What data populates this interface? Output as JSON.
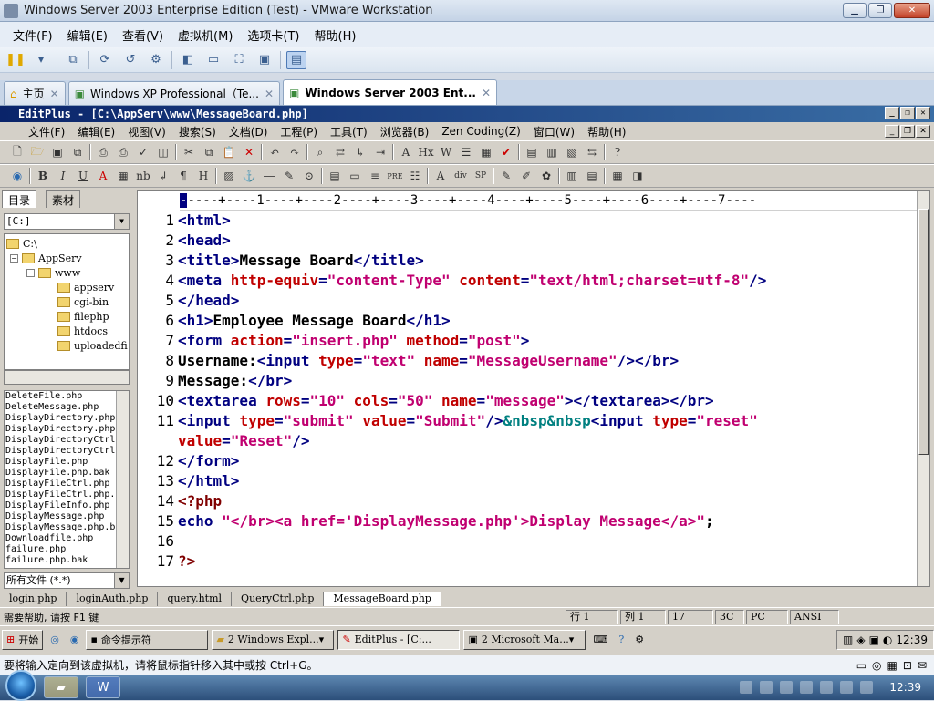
{
  "vmware": {
    "title": "Windows Server 2003 Enterprise Edition (Test) - VMware Workstation",
    "menu": [
      "文件(F)",
      "编辑(E)",
      "查看(V)",
      "虚拟机(M)",
      "选项卡(T)",
      "帮助(H)"
    ],
    "tabs": [
      {
        "label": "主页"
      },
      {
        "label": "Windows XP Professional（Te..."
      },
      {
        "label": "Windows Server 2003 Ent..."
      }
    ]
  },
  "editplus": {
    "title": "EditPlus - [C:\\AppServ\\www\\MessageBoard.php]",
    "menu": [
      "文件(F)",
      "编辑(E)",
      "视图(V)",
      "搜索(S)",
      "文档(D)",
      "工程(P)",
      "工具(T)",
      "浏览器(B)",
      "Zen Coding(Z)",
      "窗口(W)",
      "帮助(H)"
    ],
    "left_tabs": [
      "目录",
      "素材"
    ],
    "drive": "[C:]",
    "tree": [
      "C:\\",
      "AppServ",
      "www",
      "appserv",
      "cgi-bin",
      "filephp",
      "htdocs",
      "uploadedfi"
    ],
    "files": [
      "DeleteFile.php",
      "DeleteMessage.php",
      "DisplayDirectory.php",
      "DisplayDirectory.php",
      "DisplayDirectoryCtrl",
      "DisplayDirectoryCtrl",
      "DisplayFile.php",
      "DisplayFile.php.bak",
      "DisplayFileCtrl.php",
      "DisplayFileCtrl.php.",
      "DisplayFileInfo.php",
      "DisplayMessage.php",
      "DisplayMessage.php.b",
      "Downloadfile.php",
      "failure.php",
      "failure.php.bak"
    ],
    "filter": "所有文件 (*.*)",
    "ruler": "----+----1----+----2----+----3----+----4----+----5----+----6----+----7----",
    "line_numbers": [
      "1",
      "2",
      "3",
      "4",
      "5",
      "6",
      "7",
      "8",
      "9",
      "10",
      "11",
      "",
      "12",
      "13",
      "14",
      "15",
      "16",
      "17"
    ],
    "doc_tabs": [
      "login.php",
      "loginAuth.php",
      "query.html",
      "QueryCtrl.php",
      "MessageBoard.php"
    ],
    "status": {
      "help": "需要帮助, 请按 F1 键",
      "row": "行 1",
      "col": "列 1",
      "n1": "17",
      "n2": "3C",
      "mode": "PC",
      "enc": "ANSI"
    }
  },
  "guest_taskbar": {
    "start": "开始",
    "items": [
      "命令提示符",
      "2 Windows Expl...",
      "EditPlus - [C:...",
      "2 Microsoft Ma..."
    ],
    "clock": "12:39"
  },
  "hint": "要将输入定向到该虚拟机，请将鼠标指针移入其中或按 Ctrl+G。",
  "host_clock": "12:39"
}
